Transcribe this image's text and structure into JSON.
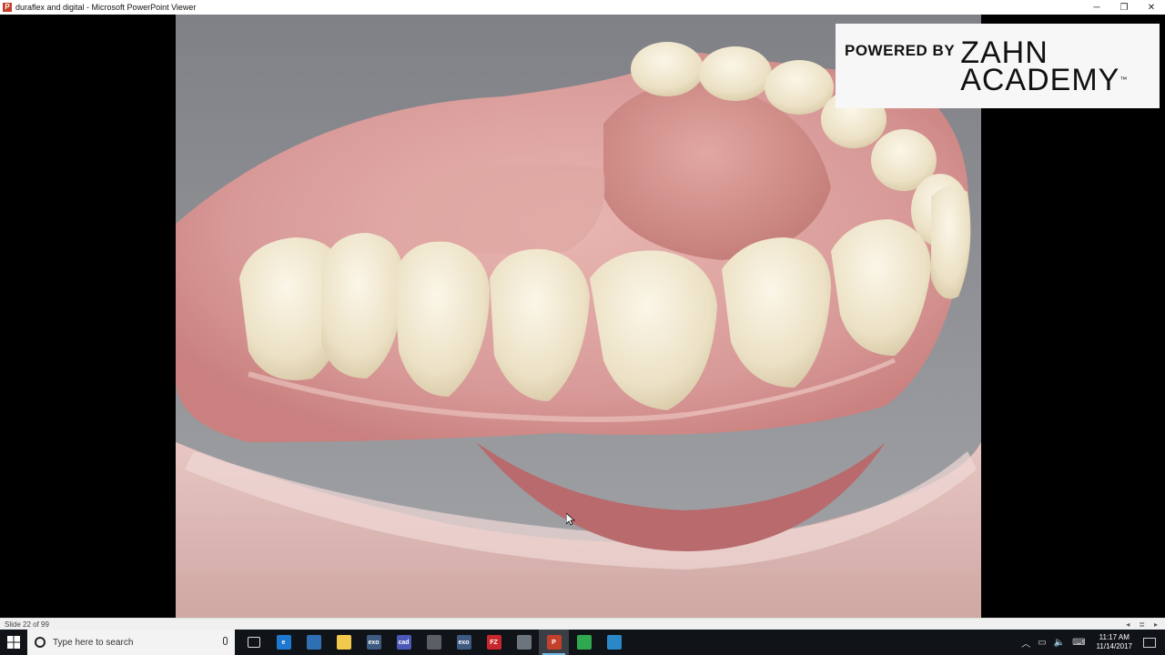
{
  "window": {
    "title": "duraflex and digital - Microsoft PowerPoint Viewer",
    "app_icon_letter": "P",
    "controls": {
      "minimize": "─",
      "restore": "❐",
      "close": "✕"
    }
  },
  "slide": {
    "image_subject": "denture-photo",
    "logo": {
      "prefix": "POWERED BY",
      "line1": "ZAHN",
      "line2": "ACADEMY",
      "tm": "™"
    }
  },
  "statusbar": {
    "slide_counter": "Slide 22 of 99"
  },
  "taskbar": {
    "search_placeholder": "Type here to search",
    "pinned": [
      {
        "name": "task-view",
        "label": "",
        "color": "#101418"
      },
      {
        "name": "edge",
        "label": "e",
        "color": "#1e78d2"
      },
      {
        "name": "store",
        "label": "",
        "color": "#2f6fb3"
      },
      {
        "name": "file-explorer",
        "label": "",
        "color": "#f2c94c"
      },
      {
        "name": "exocad-1",
        "label": "exo",
        "color": "#3d5a80"
      },
      {
        "name": "cad",
        "label": "cad",
        "color": "#4a58b8"
      },
      {
        "name": "mail",
        "label": "",
        "color": "#5a5f66"
      },
      {
        "name": "exocad-2",
        "label": "exo",
        "color": "#3d5a80"
      },
      {
        "name": "filezilla",
        "label": "FZ",
        "color": "#c8282d"
      },
      {
        "name": "notepad",
        "label": "",
        "color": "#6c757d"
      },
      {
        "name": "powerpoint",
        "label": "P",
        "color": "#c4402b"
      },
      {
        "name": "chrome",
        "label": "",
        "color": "#2fa84f"
      },
      {
        "name": "snowflake-app",
        "label": "",
        "color": "#2a88c8"
      }
    ],
    "clock": {
      "time": "11:17 AM",
      "date": "11/14/2017"
    }
  },
  "colors": {
    "taskbar_bg": "#101418",
    "background_gray": "#8e8f94",
    "gum_pink": "#d99e9e",
    "tooth_ivory": "#efe6cf"
  }
}
